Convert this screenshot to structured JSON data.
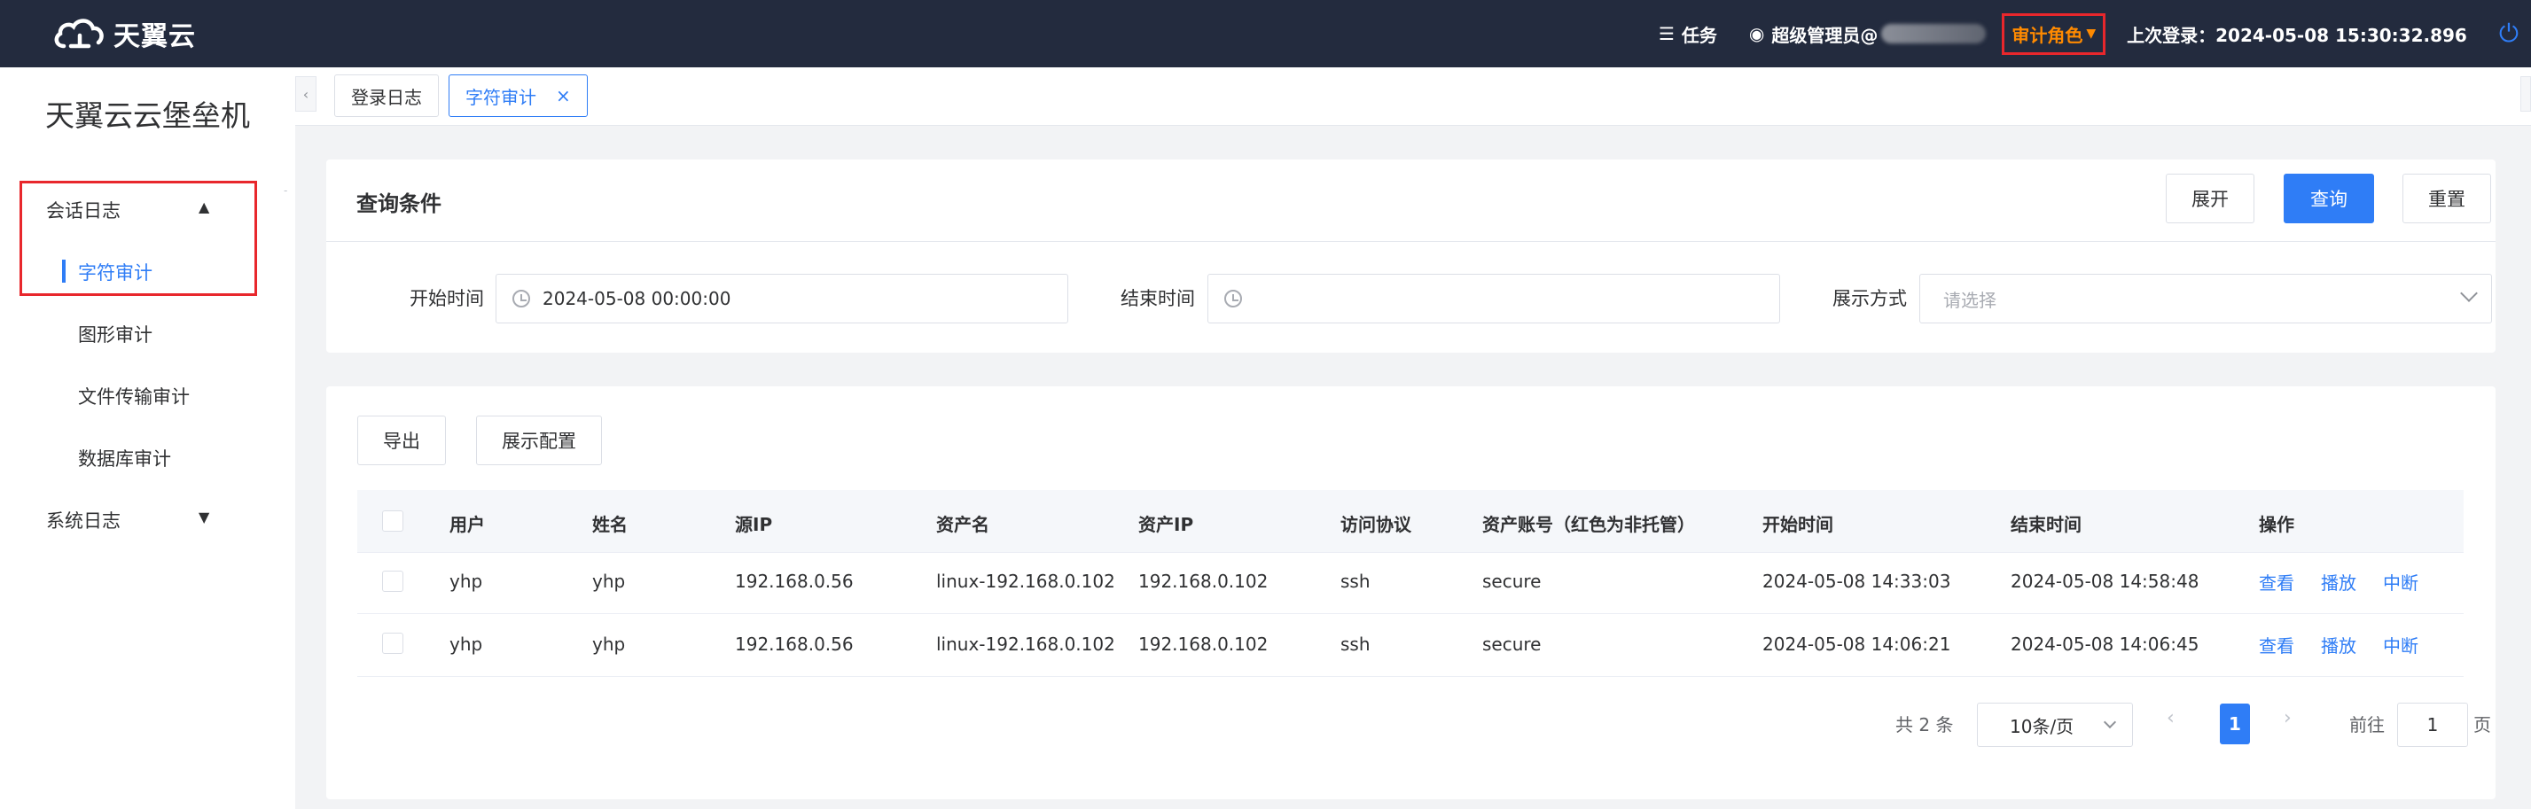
{
  "header": {
    "logo_text": "天翼云",
    "tasks_label": "任务",
    "admin_label": "超级管理员@",
    "role_label": "审计角色",
    "last_login": "上次登录：2024-05-08 15:30:32.896",
    "colors": {
      "bg": "#232b3e",
      "accent": "#2f7df6",
      "role": "#ff8a00",
      "highlight_border": "#e8272c"
    }
  },
  "sidebar": {
    "title": "天翼云云堡垒机",
    "groups": [
      {
        "label": "会话日志",
        "expanded": true,
        "items": [
          "字符审计",
          "图形审计",
          "文件传输审计",
          "数据库审计"
        ],
        "active": "字符审计"
      },
      {
        "label": "系统日志",
        "expanded": false
      }
    ]
  },
  "tabs": [
    {
      "label": "登录日志",
      "active": false
    },
    {
      "label": "字符审计",
      "active": true,
      "close": "×"
    }
  ],
  "query": {
    "title": "查询条件",
    "expand_label": "展开",
    "search_label": "查询",
    "reset_label": "重置",
    "fields": {
      "start_label": "开始时间",
      "start_value": "2024-05-08 00:00:00",
      "end_label": "结束时间",
      "end_value": "",
      "display_label": "展示方式",
      "display_placeholder": "请选择"
    }
  },
  "table": {
    "export_label": "导出",
    "config_label": "展示配置",
    "columns": [
      "用户",
      "姓名",
      "源IP",
      "资产名",
      "资产IP",
      "访问协议",
      "资产账号（红色为非托管）",
      "开始时间",
      "结束时间",
      "操作"
    ],
    "rows": [
      {
        "user": "yhp",
        "name": "yhp",
        "src_ip": "192.168.0.56",
        "asset_name": "linux-192.168.0.102",
        "asset_ip": "192.168.0.102",
        "protocol": "ssh",
        "account": "secure",
        "start": "2024-05-08 14:33:03",
        "end": "2024-05-08 14:58:48"
      },
      {
        "user": "yhp",
        "name": "yhp",
        "src_ip": "192.168.0.56",
        "asset_name": "linux-192.168.0.102",
        "asset_ip": "192.168.0.102",
        "protocol": "ssh",
        "account": "secure",
        "start": "2024-05-08 14:06:21",
        "end": "2024-05-08 14:06:45"
      }
    ],
    "actions": [
      "查看",
      "播放",
      "中断"
    ]
  },
  "pagination": {
    "total_text": "共 2 条",
    "page_size": "10条/页",
    "current_page": "1",
    "goto_label": "前往",
    "goto_value": "1",
    "page_suffix": "页"
  }
}
